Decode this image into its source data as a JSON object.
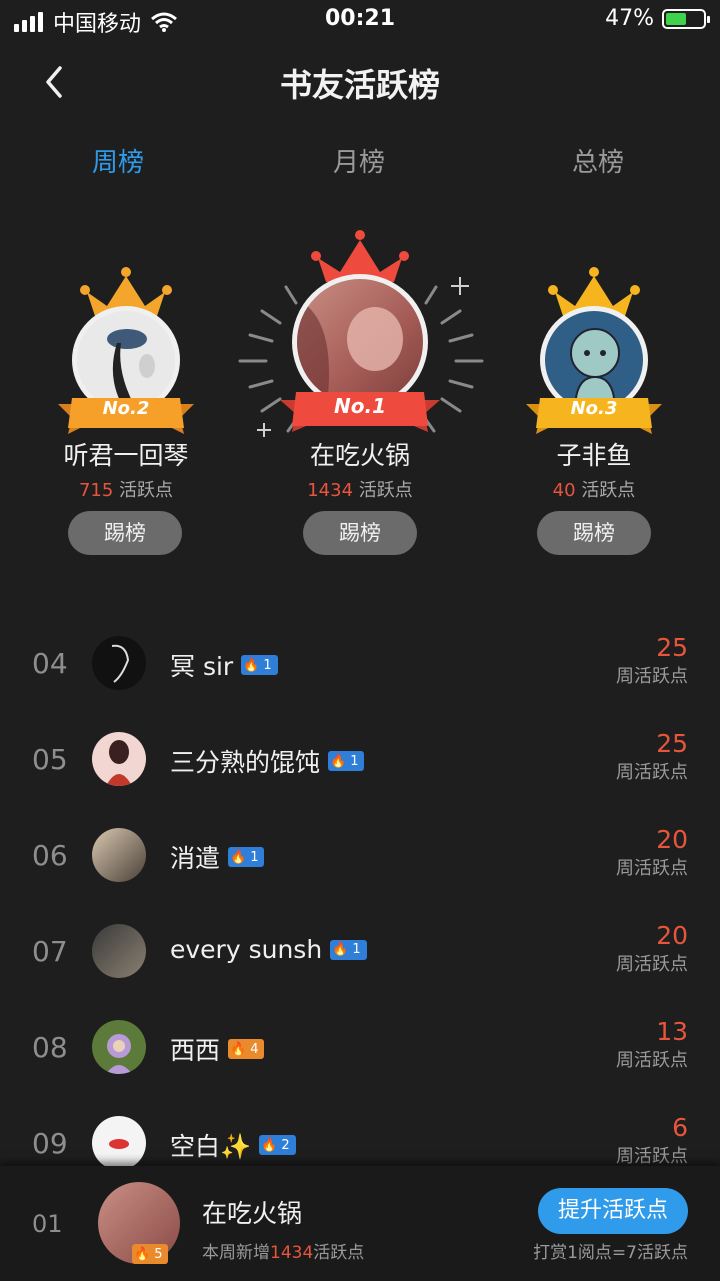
{
  "status_bar": {
    "carrier": "中国移动",
    "time": "00:21",
    "battery": "47%"
  },
  "header": {
    "title": "书友活跃榜"
  },
  "tabs": [
    {
      "label": "周榜",
      "active": true
    },
    {
      "label": "月榜",
      "active": false
    },
    {
      "label": "总榜",
      "active": false
    }
  ],
  "podium": [
    {
      "place": "No.2",
      "name": "听君一回琴",
      "score": "715",
      "unit": "活跃点",
      "button": "踢榜"
    },
    {
      "place": "No.1",
      "name": "在吃火锅",
      "score": "1434",
      "unit": "活跃点",
      "button": "踢榜"
    },
    {
      "place": "No.3",
      "name": "子非鱼",
      "score": "40",
      "unit": "活跃点",
      "button": "踢榜"
    }
  ],
  "ranking": [
    {
      "rank": "04",
      "name": "冥 sir",
      "level": "1",
      "badge_color": "blue",
      "score": "25",
      "unit": "周活跃点"
    },
    {
      "rank": "05",
      "name": "三分熟的馄饨",
      "level": "1",
      "badge_color": "blue",
      "score": "25",
      "unit": "周活跃点"
    },
    {
      "rank": "06",
      "name": "消遣",
      "level": "1",
      "badge_color": "blue",
      "score": "20",
      "unit": "周活跃点"
    },
    {
      "rank": "07",
      "name": "every  sunsh",
      "level": "1",
      "badge_color": "blue",
      "score": "20",
      "unit": "周活跃点"
    },
    {
      "rank": "08",
      "name": "西西",
      "level": "4",
      "badge_color": "orange",
      "score": "13",
      "unit": "周活跃点"
    },
    {
      "rank": "09",
      "name": "空白✨",
      "level": "2",
      "badge_color": "blue",
      "score": "6",
      "unit": "周活跃点"
    }
  ],
  "footer": {
    "rank": "01",
    "name": "在吃火锅",
    "level": "5",
    "sub_prefix": "本周新增",
    "sub_value": "1434",
    "sub_suffix": "活跃点",
    "button": "提升活跃点",
    "note": "打赏1阅点=7活跃点"
  },
  "colors": {
    "accent": "#2f9bea",
    "score": "#e8553d",
    "background": "#1e1e1f"
  }
}
